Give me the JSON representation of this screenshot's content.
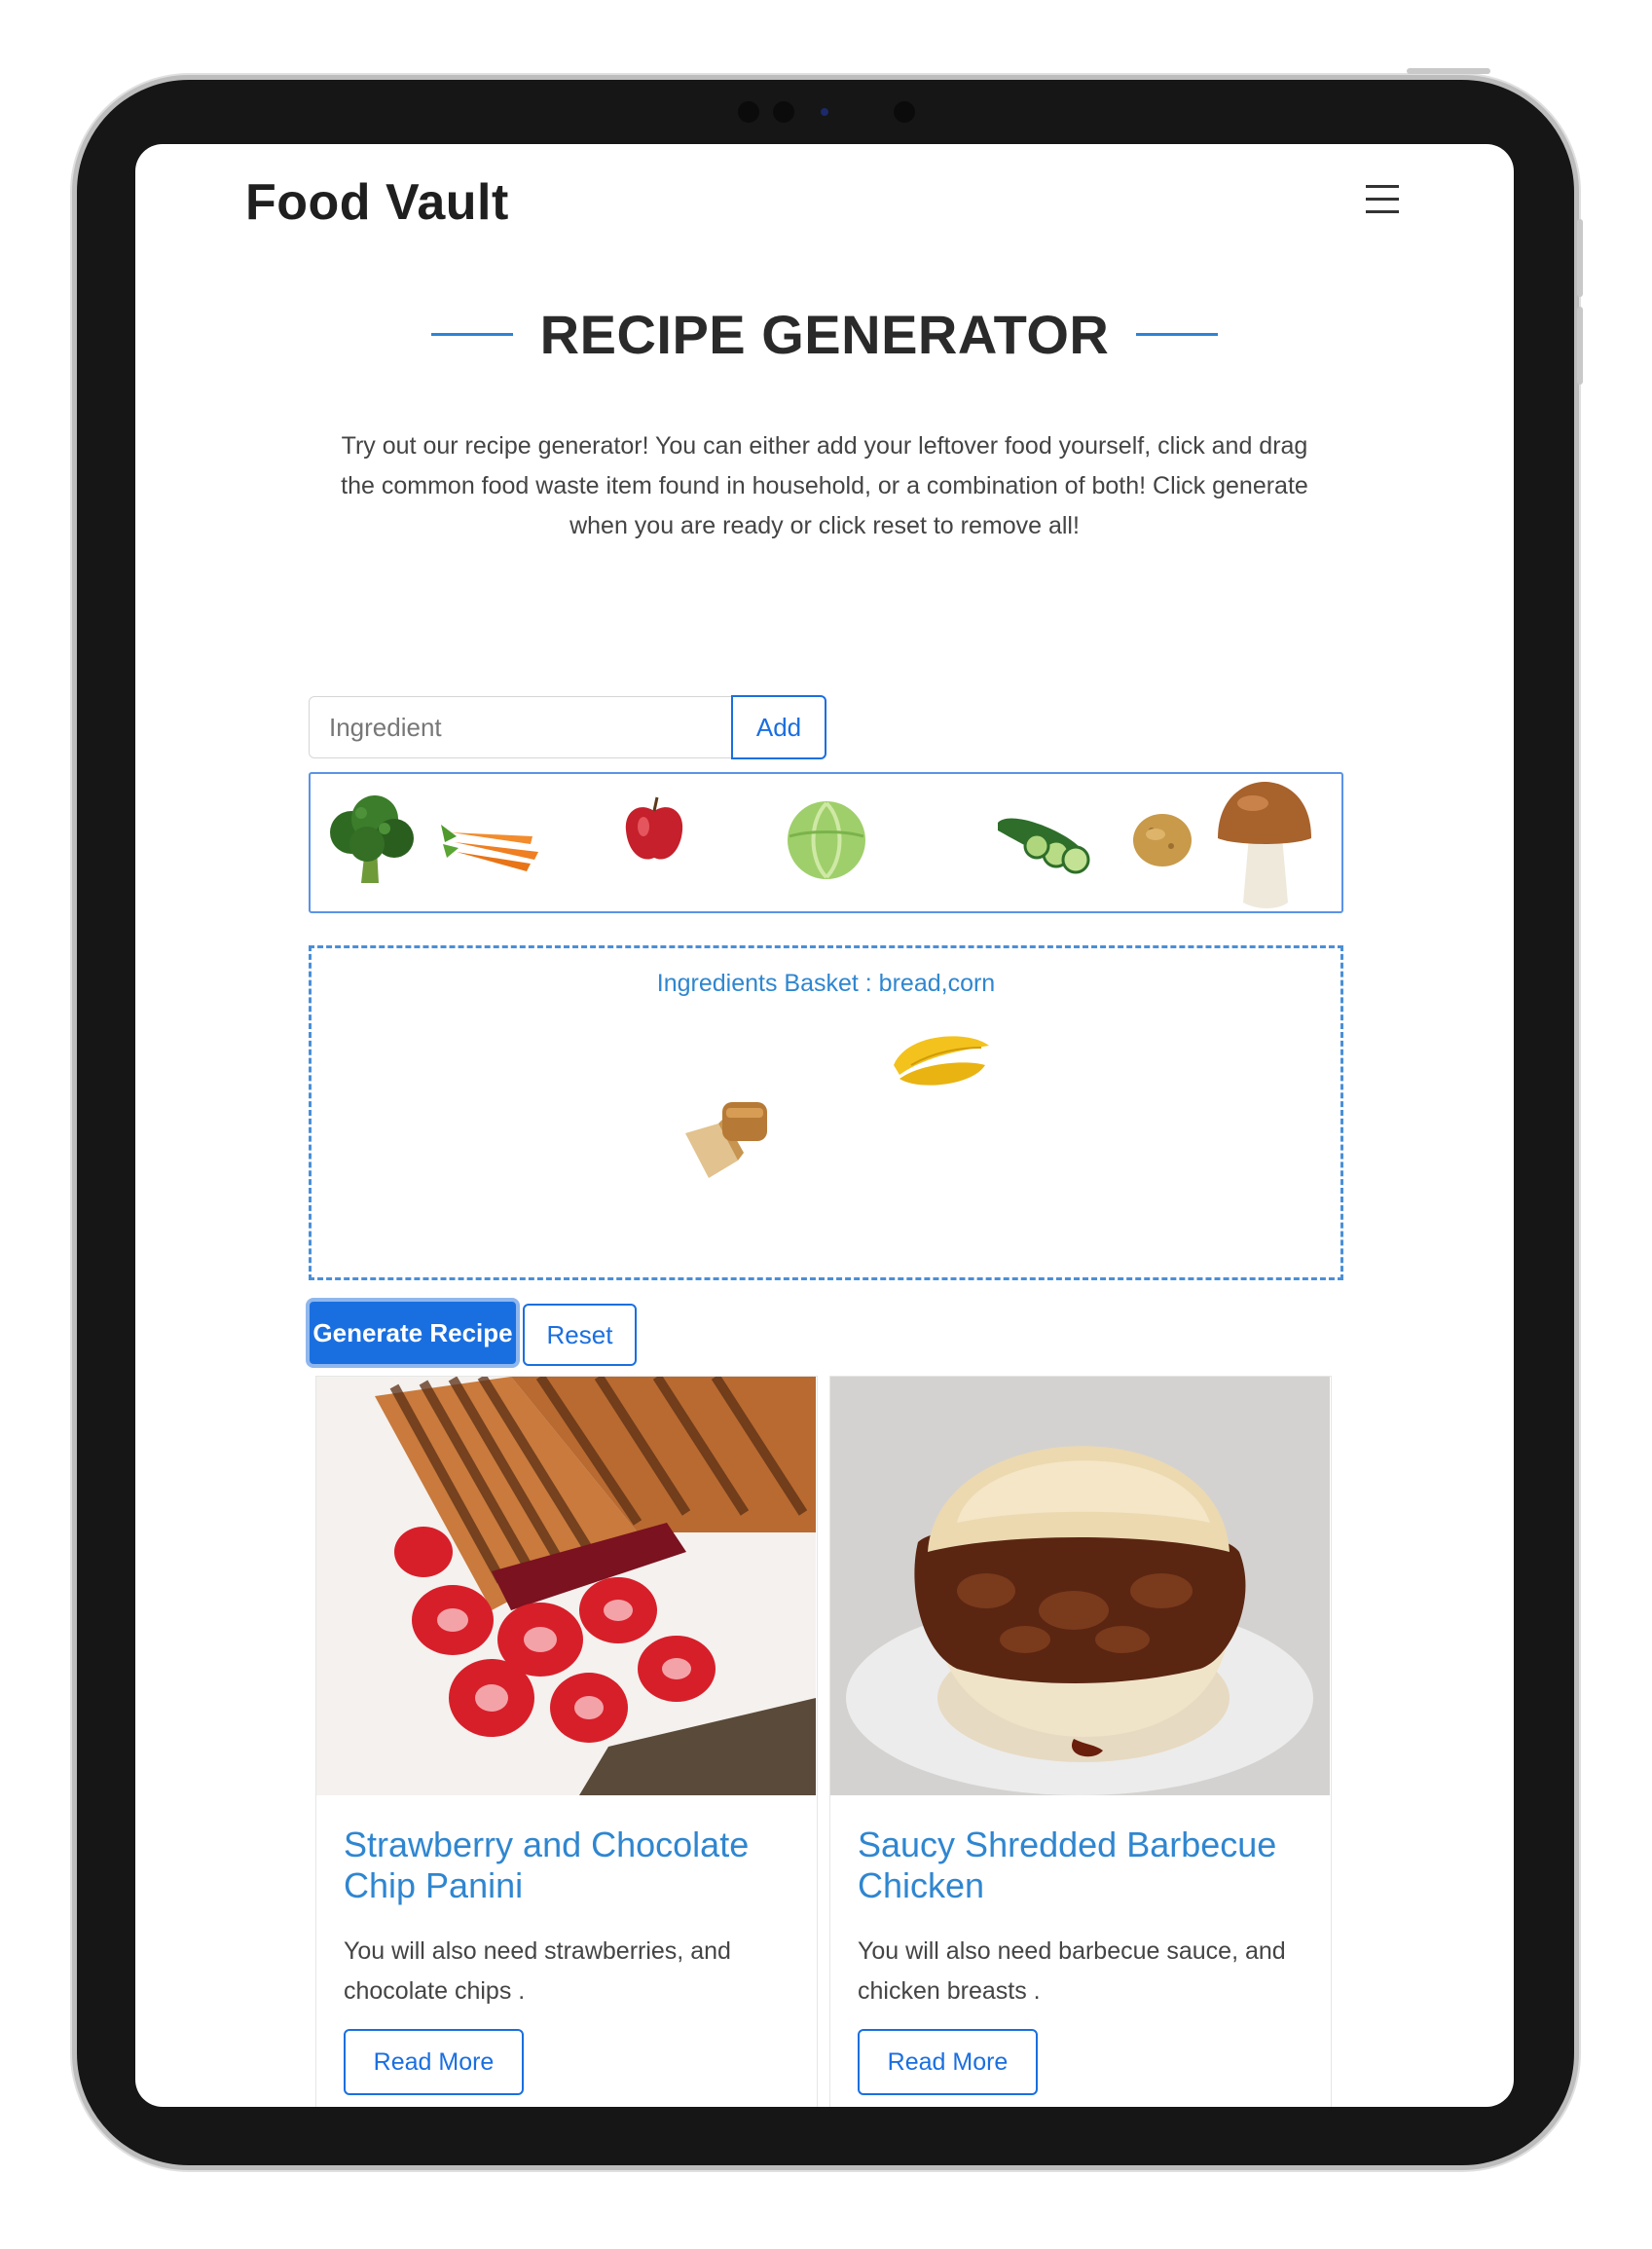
{
  "navbar": {
    "brand": "Food Vault",
    "menu_icon": "hamburger-menu-icon"
  },
  "section": {
    "title": "RECIPE GENERATOR",
    "description": "Try out our recipe generator! You can either add your leftover food yourself, click and drag the common food waste item found in household, or a combination of both! Click generate when you are ready or click reset to remove all!"
  },
  "ingredient_form": {
    "placeholder": "Ingredient",
    "add_label": "Add"
  },
  "palette_items": [
    "broccoli-icon",
    "carrots-icon",
    "apple-icon",
    "cabbage-icon",
    "cucumber-icon",
    "potato-icon",
    "mushroom-icon"
  ],
  "basket": {
    "label": "Ingredients Basket : bread,corn",
    "items": [
      "bread-icon",
      "corn-icon"
    ]
  },
  "actions": {
    "generate_label": "Generate Recipe",
    "reset_label": "Reset"
  },
  "recipes": [
    {
      "title": "Strawberry and Chocolate Chip Panini",
      "text": "You will also need strawberries, and chocolate chips .",
      "button": "Read More",
      "image": "panini-with-strawberries-photo"
    },
    {
      "title": "Saucy Shredded Barbecue Chicken",
      "text": "You will also need barbecue sauce, and chicken breasts .",
      "button": "Read More",
      "image": "bbq-chicken-sandwich-photo"
    }
  ],
  "colors": {
    "accent": "#1a6fe0",
    "link": "#2f86d0",
    "frame": "#161616"
  }
}
